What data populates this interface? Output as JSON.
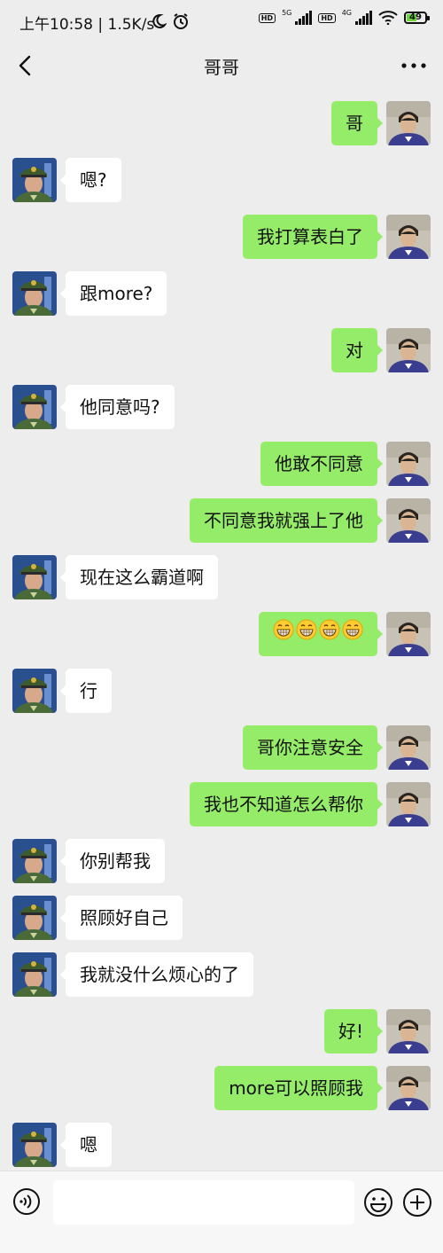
{
  "status_bar": {
    "time_text": "上午10:58 | 1.5K/s",
    "sim1": {
      "badge": "HD",
      "network": "5G"
    },
    "sim2": {
      "badge": "HD",
      "network": "4G"
    },
    "battery_percent": "49",
    "icons": [
      "moon-icon",
      "alarm-icon",
      "signal-icon",
      "wifi-icon",
      "battery-icon"
    ]
  },
  "nav": {
    "title": "哥哥",
    "back_icon": "chevron-left-icon",
    "more_icon": "more-icon"
  },
  "colors": {
    "background": "#ededed",
    "sent_bubble": "#95ec69",
    "received_bubble": "#ffffff",
    "input_bar": "#f7f7f7"
  },
  "messages": [
    {
      "side": "right",
      "text": "哥"
    },
    {
      "side": "left",
      "text": "嗯?"
    },
    {
      "side": "right",
      "text": "我打算表白了"
    },
    {
      "side": "left",
      "text": "跟more?"
    },
    {
      "side": "right",
      "text": "对"
    },
    {
      "side": "left",
      "text": "他同意吗?"
    },
    {
      "side": "right",
      "text": "他敢不同意"
    },
    {
      "side": "right",
      "text": "不同意我就强上了他"
    },
    {
      "side": "left",
      "text": "现在这么霸道啊"
    },
    {
      "side": "right",
      "text": "",
      "emoji": [
        "grin-emoji",
        "grin-emoji",
        "grin-emoji",
        "grin-emoji"
      ]
    },
    {
      "side": "left",
      "text": "行"
    },
    {
      "side": "right",
      "text": "哥你注意安全"
    },
    {
      "side": "right",
      "text": "我也不知道怎么帮你"
    },
    {
      "side": "left",
      "text": "你别帮我"
    },
    {
      "side": "left",
      "text": "照顾好自己"
    },
    {
      "side": "left",
      "text": "我就没什么烦心的了"
    },
    {
      "side": "right",
      "text": "好!"
    },
    {
      "side": "right",
      "text": "more可以照顾我"
    },
    {
      "side": "left",
      "text": "嗯"
    }
  ],
  "input_bar": {
    "placeholder": "",
    "value": "",
    "icons": [
      "voice-icon",
      "emoji-icon",
      "plus-icon"
    ]
  }
}
